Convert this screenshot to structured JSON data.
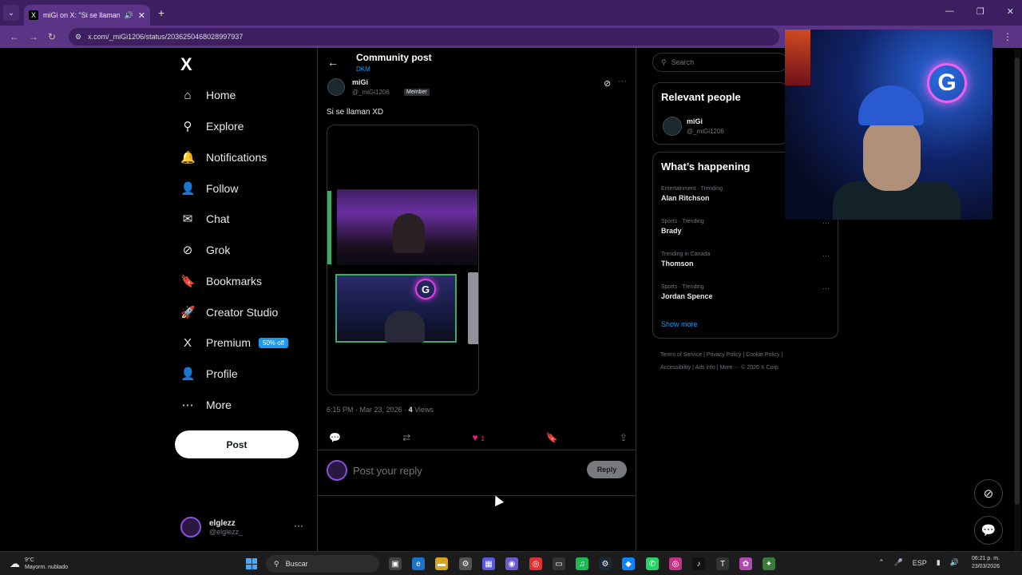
{
  "browser": {
    "tab_title": "miGi on X: \"Si se llaman XD\"",
    "tab_favicon": "X",
    "url": "x.com/_miGi1206/status/2036250468028997937"
  },
  "sidebar": {
    "logo": "X",
    "items": [
      {
        "label": "Home",
        "icon": "home-icon",
        "glyph": "⌂"
      },
      {
        "label": "Explore",
        "icon": "search-icon",
        "glyph": "⚲"
      },
      {
        "label": "Notifications",
        "icon": "bell-icon",
        "glyph": "🔔"
      },
      {
        "label": "Follow",
        "icon": "person-plus-icon",
        "glyph": "👤"
      },
      {
        "label": "Chat",
        "icon": "mail-icon",
        "glyph": "✉"
      },
      {
        "label": "Grok",
        "icon": "grok-icon",
        "glyph": "⊘"
      },
      {
        "label": "Bookmarks",
        "icon": "bookmark-icon",
        "glyph": "🔖"
      },
      {
        "label": "Creator Studio",
        "icon": "rocket-icon",
        "glyph": "🚀"
      },
      {
        "label": "Premium",
        "icon": "x-logo-icon",
        "glyph": "X"
      },
      {
        "label": "Profile",
        "icon": "person-icon",
        "glyph": "👤"
      },
      {
        "label": "More",
        "icon": "more-circle-icon",
        "glyph": "⋯"
      }
    ],
    "premium_badge": "50% off",
    "post_button": "Post",
    "account": {
      "name": "elglezz",
      "handle": "@elglezz_"
    }
  },
  "post": {
    "page_title": "Community post",
    "community": "DKM",
    "author_name": "miGi",
    "author_handle": "@_miGi1206",
    "member_badge": "Member",
    "text": "Si se llaman XD",
    "timestamp": "6:15 PM · Mar 23, 2026 ·",
    "views_count": "4",
    "views_label": "Views",
    "like_count": "1",
    "reply_placeholder": "Post your reply",
    "reply_button": "Reply"
  },
  "right": {
    "search_placeholder": "Search",
    "relevant_title": "Relevant people",
    "relevant_name": "miGi",
    "relevant_handle": "@_miGi1206",
    "happening_title": "What’s happening",
    "trends": [
      {
        "context": "Entertainment · Trending",
        "title": "Alan Ritchson"
      },
      {
        "context": "Sports · Trending",
        "title": "Brady"
      },
      {
        "context": "Trending in Canada",
        "title": "Thomson"
      },
      {
        "context": "Sports · Trending",
        "title": "Jordan Spence"
      }
    ],
    "show_more": "Show more",
    "footer_line1": "Terms of Service  |  Privacy Policy  |  Cookie Policy  |",
    "footer_line2": "Accessibility  |  Ads info  |  More ···  © 2026 X Corp."
  },
  "taskbar": {
    "temperature": "9°C",
    "weather_text": "Mayorm. nublado",
    "search_label": "Buscar",
    "language": "ESP",
    "time": "06:21 p. m.",
    "date": "23/03/2026"
  },
  "colors": {
    "accent": "#1d9bf0",
    "like": "#f91880",
    "tab_bar": "#3c1f5e"
  }
}
